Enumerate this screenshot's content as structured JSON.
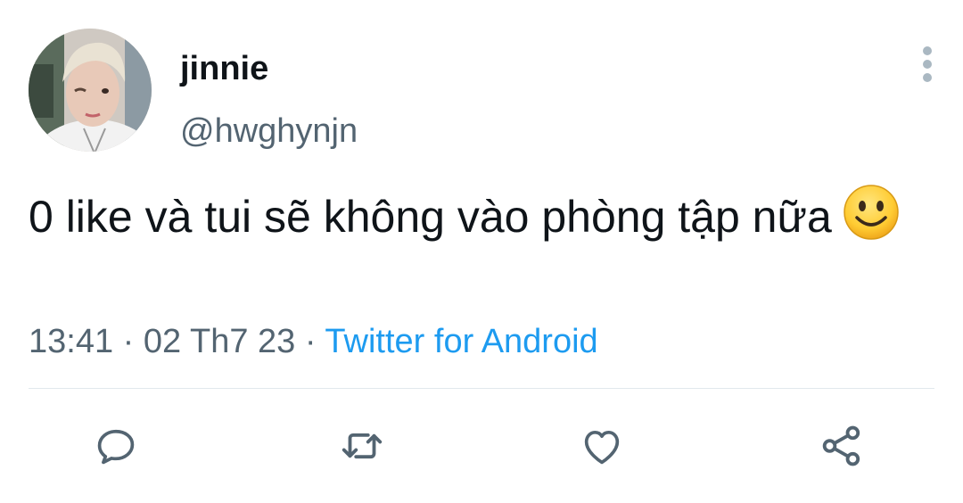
{
  "tweet": {
    "display_name": "jinnie",
    "handle": "@hwghynjn",
    "text": "0 like và tui sẽ không vào phòng tập nữa",
    "emoji": "slightly-smiling-face",
    "time": "13:41",
    "separator_1": " · ",
    "date": "02 Th7 23",
    "separator_2": " · ",
    "source": "Twitter for Android"
  },
  "actions": {
    "icons": [
      "reply-icon",
      "retweet-icon",
      "like-icon",
      "share-icon"
    ]
  },
  "colors": {
    "text": "#0f1419",
    "secondary": "#536471",
    "link": "#1d9bf0",
    "icon": "#536471",
    "divider": "#e1e8ed",
    "menu_dots": "#aab8c2"
  }
}
